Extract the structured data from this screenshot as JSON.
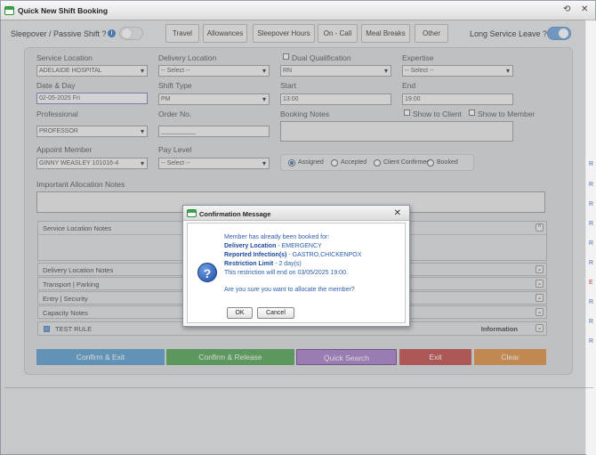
{
  "window": {
    "title": "Quick New Shift Booking",
    "restore_glyph": "⟲",
    "close_glyph": "✕",
    "side_strip_letters": [
      "R",
      "R",
      "R",
      "R",
      "R",
      "R",
      "E",
      "R",
      "R",
      "R"
    ]
  },
  "topbar": {
    "sleepover_label": "Sleepover / Passive Shift ?",
    "info_glyph": "i",
    "sleepover_toggle_on": false,
    "tabs": [
      "Travel",
      "Allowances",
      "Sleepover Hours",
      "On - Call",
      "Meal Breaks",
      "Other"
    ],
    "long_service_label": "Long Service Leave ?",
    "long_service_toggle_on": true
  },
  "form": {
    "service_location": {
      "label": "Service Location",
      "value": "ADELAIDE HOSPITAL"
    },
    "delivery_location": {
      "label": "Delivery Location",
      "value": "-- Select --"
    },
    "dual_qualification": {
      "label": "Dual Qualification",
      "value": "RN",
      "checked": false
    },
    "expertise": {
      "label": "Expertise",
      "value": "-- Select --"
    },
    "date_day": {
      "label": "Date & Day",
      "value": "02-05-2025 Fri"
    },
    "shift_type": {
      "label": "Shift Type",
      "value": "PM"
    },
    "start": {
      "label": "Start",
      "value": "13:00"
    },
    "end": {
      "label": "End",
      "value": "19:00"
    },
    "professional": {
      "label": "Professional",
      "value": "PROFESSOR"
    },
    "order_no": {
      "label": "Order No.",
      "value": "__________"
    },
    "booking_notes": {
      "label": "Booking Notes"
    },
    "show_to_client": {
      "label": "Show to Client",
      "checked": false
    },
    "show_to_member": {
      "label": "Show to Member",
      "checked": false
    },
    "appoint_member": {
      "label": "Appoint Member",
      "value": "GINNY WEASLEY 101016-4"
    },
    "pay_level": {
      "label": "Pay Level",
      "value": "-- Select --"
    },
    "status_options": [
      {
        "label": "Assigned",
        "checked": true
      },
      {
        "label": "Accepted",
        "checked": false
      },
      {
        "label": "Client Confirmed",
        "checked": false
      },
      {
        "label": "Booked",
        "checked": false
      }
    ],
    "allocation_notes_label": "Important Allocation Notes"
  },
  "sections": {
    "service_location_notes": "Service Location Notes",
    "delivery_location_notes": "Delivery Location Notes",
    "transport_parking": "Transport | Parking",
    "entry_security": "Entry | Security",
    "capacity_notes": "Capacity Notes",
    "test_rule": "TEST RULE",
    "information": "Information",
    "expand_glyph": "⌄",
    "collapse_glyph": "^"
  },
  "actions": [
    {
      "label": "Confirm & Exit",
      "color": "#5b9fd0"
    },
    {
      "label": "Confirm & Release",
      "color": "#53a454"
    },
    {
      "label": "Quick Search",
      "color": "#a57ec9"
    },
    {
      "label": "Exit",
      "color": "#c24b4b"
    },
    {
      "label": "Clear",
      "color": "#df8f43"
    }
  ],
  "dialog": {
    "title": "Confirmation Message",
    "close_glyph": "✕",
    "icon_glyph": "?",
    "line1": "Member has already been booked for:",
    "delivery_label": "Delivery Location",
    "delivery_value": "- EMERGENCY",
    "infection_label": "Reported Infection(s)",
    "infection_value": "- GASTRO,CHICKENPOX",
    "restriction_label": "Restriction Limit",
    "restriction_value": "- 2 day(s)",
    "restriction_end": "This restriction will end on 03/05/2025 19:00.",
    "question": "Are you sure you want to allocate the member?",
    "ok_label": "OK",
    "cancel_label": "Cancel"
  }
}
